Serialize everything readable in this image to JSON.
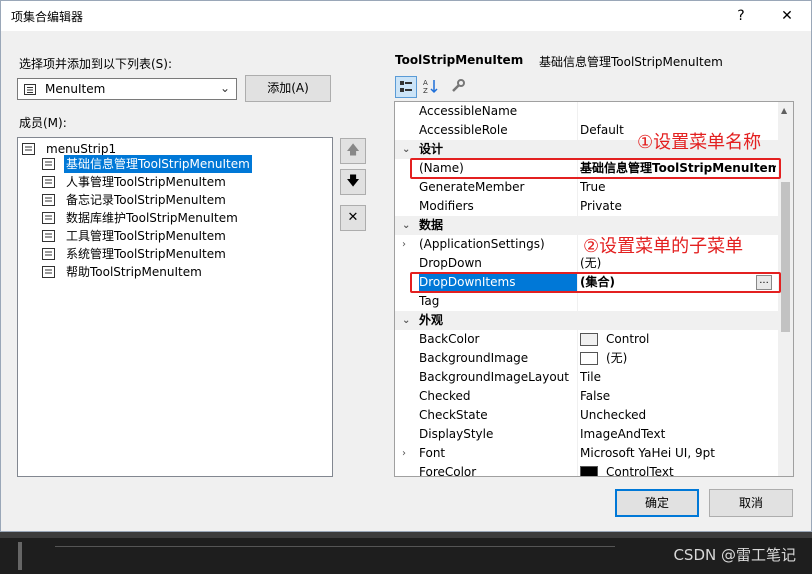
{
  "window": {
    "title": "项集合编辑器",
    "help_glyph": "?",
    "close_glyph": "✕"
  },
  "left": {
    "select_label": "选择项并添加到以下列表(S):",
    "combo_value": "MenuItem",
    "add_button": "添加(A)",
    "members_label": "成员(M):",
    "tree_root": "menuStrip1",
    "tree_items": [
      "基础信息管理ToolStripMenuItem",
      "人事管理ToolStripMenuItem",
      "备忘记录ToolStripMenuItem",
      "数据库维护ToolStripMenuItem",
      "工具管理ToolStripMenuItem",
      "系统管理ToolStripMenuItem",
      "帮助ToolStripMenuItem"
    ],
    "up_glyph": "🡅",
    "down_glyph": "🡇",
    "delete_glyph": "✕"
  },
  "right": {
    "object_type": "ToolStripMenuItem",
    "object_name": "基础信息管理ToolStripMenuItem",
    "rows": [
      {
        "kind": "prop",
        "name": "AccessibleName",
        "value": ""
      },
      {
        "kind": "prop",
        "name": "AccessibleRole",
        "value": "Default"
      },
      {
        "kind": "cat",
        "name": "设计"
      },
      {
        "kind": "prop",
        "name": "(Name)",
        "value": "基础信息管理ToolStripMenuItem",
        "bold": true
      },
      {
        "kind": "prop",
        "name": "GenerateMember",
        "value": "True"
      },
      {
        "kind": "prop",
        "name": "Modifiers",
        "value": "Private"
      },
      {
        "kind": "cat",
        "name": "数据"
      },
      {
        "kind": "prop",
        "name": "(ApplicationSettings)",
        "value": "",
        "expander": true
      },
      {
        "kind": "prop",
        "name": "DropDown",
        "value": "(无)"
      },
      {
        "kind": "prop",
        "name": "DropDownItems",
        "value": "(集合)",
        "bold": true,
        "selected": true,
        "ellipsis": "..."
      },
      {
        "kind": "prop",
        "name": "Tag",
        "value": ""
      },
      {
        "kind": "cat",
        "name": "外观"
      },
      {
        "kind": "prop",
        "name": "BackColor",
        "value": "Control",
        "swatch": "#f0f0f0"
      },
      {
        "kind": "prop",
        "name": "BackgroundImage",
        "value": "(无)",
        "swatch": "#ffffff"
      },
      {
        "kind": "prop",
        "name": "BackgroundImageLayout",
        "value": "Tile"
      },
      {
        "kind": "prop",
        "name": "Checked",
        "value": "False"
      },
      {
        "kind": "prop",
        "name": "CheckState",
        "value": "Unchecked"
      },
      {
        "kind": "prop",
        "name": "DisplayStyle",
        "value": "ImageAndText"
      },
      {
        "kind": "prop",
        "name": "Font",
        "value": "Microsoft YaHei UI, 9pt",
        "expander": true
      },
      {
        "kind": "prop",
        "name": "ForeColor",
        "value": "ControlText",
        "swatch": "#000000"
      }
    ]
  },
  "annotations": {
    "name_note": "①设置菜单名称",
    "items_note": "②设置菜单的子菜单"
  },
  "buttons": {
    "ok": "确定",
    "cancel": "取消"
  },
  "watermark": "CSDN @雷工笔记",
  "colors": {
    "accent": "#0078d7",
    "annotation": "#e32020"
  }
}
